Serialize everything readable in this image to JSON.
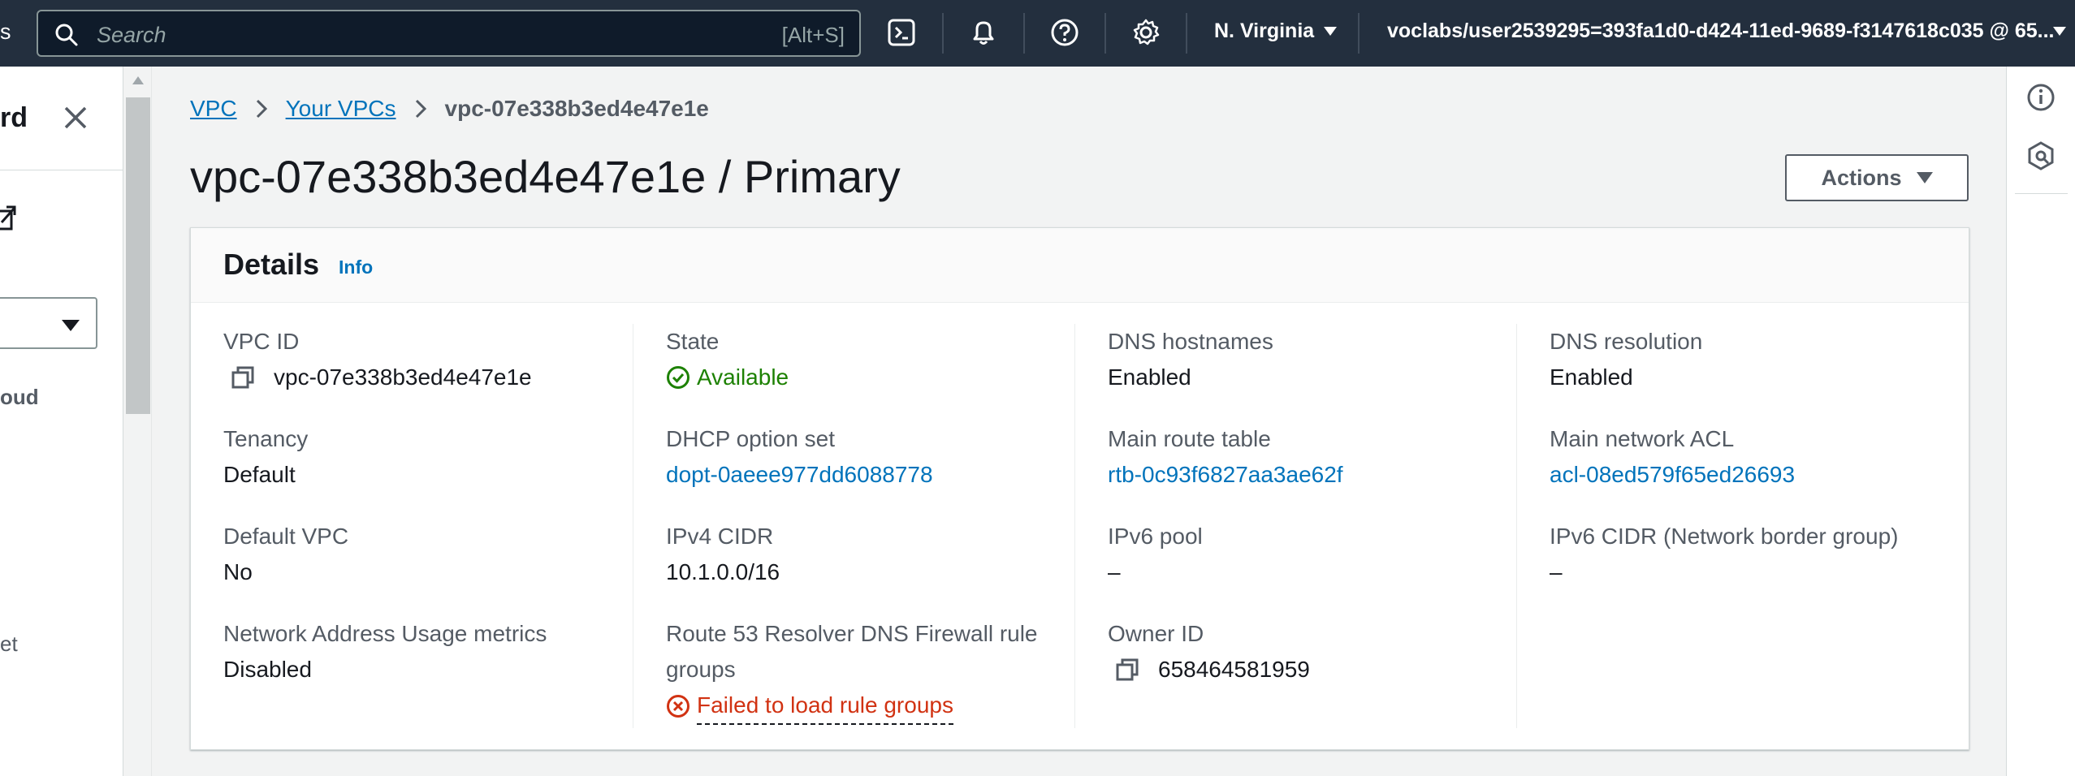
{
  "nav": {
    "edge_text": "s",
    "search_placeholder": "Search",
    "search_shortcut": "[Alt+S]",
    "icons": [
      "cloudshell-icon",
      "bell-icon",
      "help-icon",
      "gear-icon"
    ],
    "region": "N. Virginia",
    "account": "voclabs/user2539295=393fa1d0-d424-11ed-9689-f3147618c035 @ 65..."
  },
  "left_panel": {
    "title_fragment": "rd",
    "item1_fragment": "oud",
    "item2_fragment": "et"
  },
  "breadcrumb": {
    "items": [
      "VPC",
      "Your VPCs"
    ],
    "current": "vpc-07e338b3ed4e47e1e"
  },
  "page": {
    "title": "vpc-07e338b3ed4e47e1e / Primary",
    "actions_label": "Actions"
  },
  "details": {
    "title": "Details",
    "info": "Info",
    "columns": [
      [
        {
          "label": "VPC ID",
          "value": "vpc-07e338b3ed4e47e1e"
        },
        {
          "label": "Tenancy",
          "value": "Default"
        },
        {
          "label": "Default VPC",
          "value": "No"
        },
        {
          "label": "Network Address Usage metrics",
          "value": "Disabled"
        }
      ],
      [
        {
          "label": "State",
          "value": "Available"
        },
        {
          "label": "DHCP option set",
          "value": "dopt-0aeee977dd6088778"
        },
        {
          "label": "IPv4 CIDR",
          "value": "10.1.0.0/16"
        },
        {
          "label": "Route 53 Resolver DNS Firewall rule groups",
          "value": "Failed to load rule groups"
        }
      ],
      [
        {
          "label": "DNS hostnames",
          "value": "Enabled"
        },
        {
          "label": "Main route table",
          "value": "rtb-0c93f6827aa3ae62f"
        },
        {
          "label": "IPv6 pool",
          "value": "–"
        },
        {
          "label": "Owner ID",
          "value": "658464581959"
        }
      ],
      [
        {
          "label": "DNS resolution",
          "value": "Enabled"
        },
        {
          "label": "Main network ACL",
          "value": "acl-08ed579f65ed26693"
        },
        {
          "label": "IPv6 CIDR (Network border group)",
          "value": "–"
        }
      ]
    ]
  },
  "colors": {
    "nav_bg": "#232f3e",
    "link": "#0073bb",
    "success": "#1d8102",
    "error": "#d13212"
  }
}
